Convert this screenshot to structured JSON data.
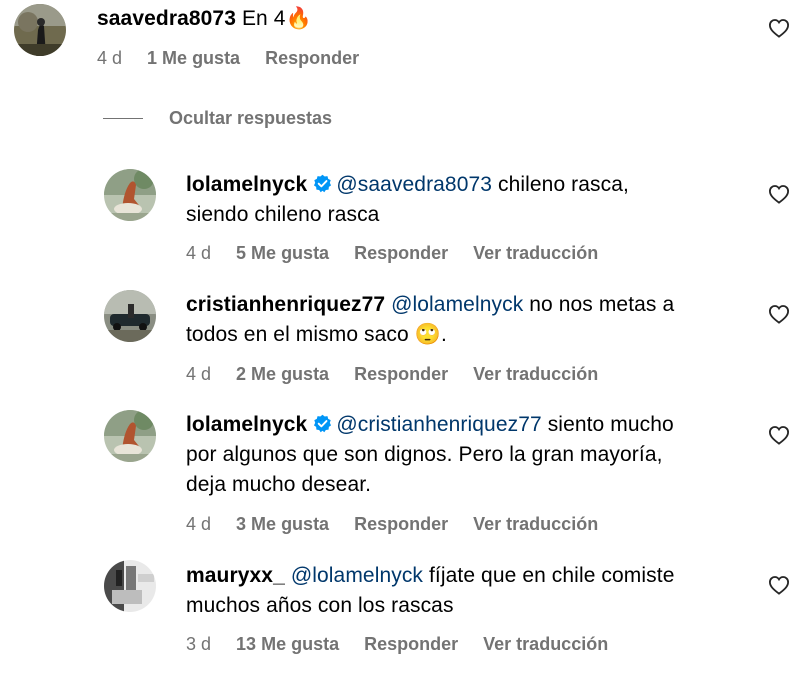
{
  "colors": {
    "mention": "#00376b",
    "meta": "#737373",
    "verified": "#0095f6"
  },
  "top_comment": {
    "username": "saavedra8073",
    "text": "En 4",
    "emoji": "🔥",
    "time": "4 d",
    "likes": "1 Me gusta",
    "reply": "Responder",
    "like_icon": "heart-icon"
  },
  "hide_replies": "Ocultar respuestas",
  "replies": [
    {
      "username": "lolamelnyck",
      "verified": true,
      "mention": "@saavedra8073",
      "line1_rest": " chileno rasca,",
      "line2": "siendo chileno rasca",
      "time": "4 d",
      "likes": "5 Me gusta",
      "reply": "Responder",
      "translate": "Ver traducción"
    },
    {
      "username": "cristianhenriquez77",
      "verified": false,
      "mention": "@lolamelnyck",
      "line1_rest": " no nos metas a",
      "line2": "todos en el mismo saco",
      "line2_emoji": "🙄",
      "line2_end": ".",
      "time": "4 d",
      "likes": "2 Me gusta",
      "reply": "Responder",
      "translate": "Ver traducción"
    },
    {
      "username": "lolamelnyck",
      "verified": true,
      "mention": "@cristianhenriquez77",
      "line1_rest": " siento mucho",
      "line2": "por algunos que son dignos. Pero la gran mayoría,",
      "line3": "deja mucho desear.",
      "time": "4 d",
      "likes": "3 Me gusta",
      "reply": "Responder",
      "translate": "Ver traducción"
    },
    {
      "username": "mauryxx_",
      "verified": false,
      "mention": "@lolamelnyck",
      "line1_rest": " fíjate que en chile comiste",
      "line2": "muchos años con los rascas",
      "time": "3 d",
      "likes": "13 Me gusta",
      "reply": "Responder",
      "translate": "Ver traducción"
    }
  ]
}
